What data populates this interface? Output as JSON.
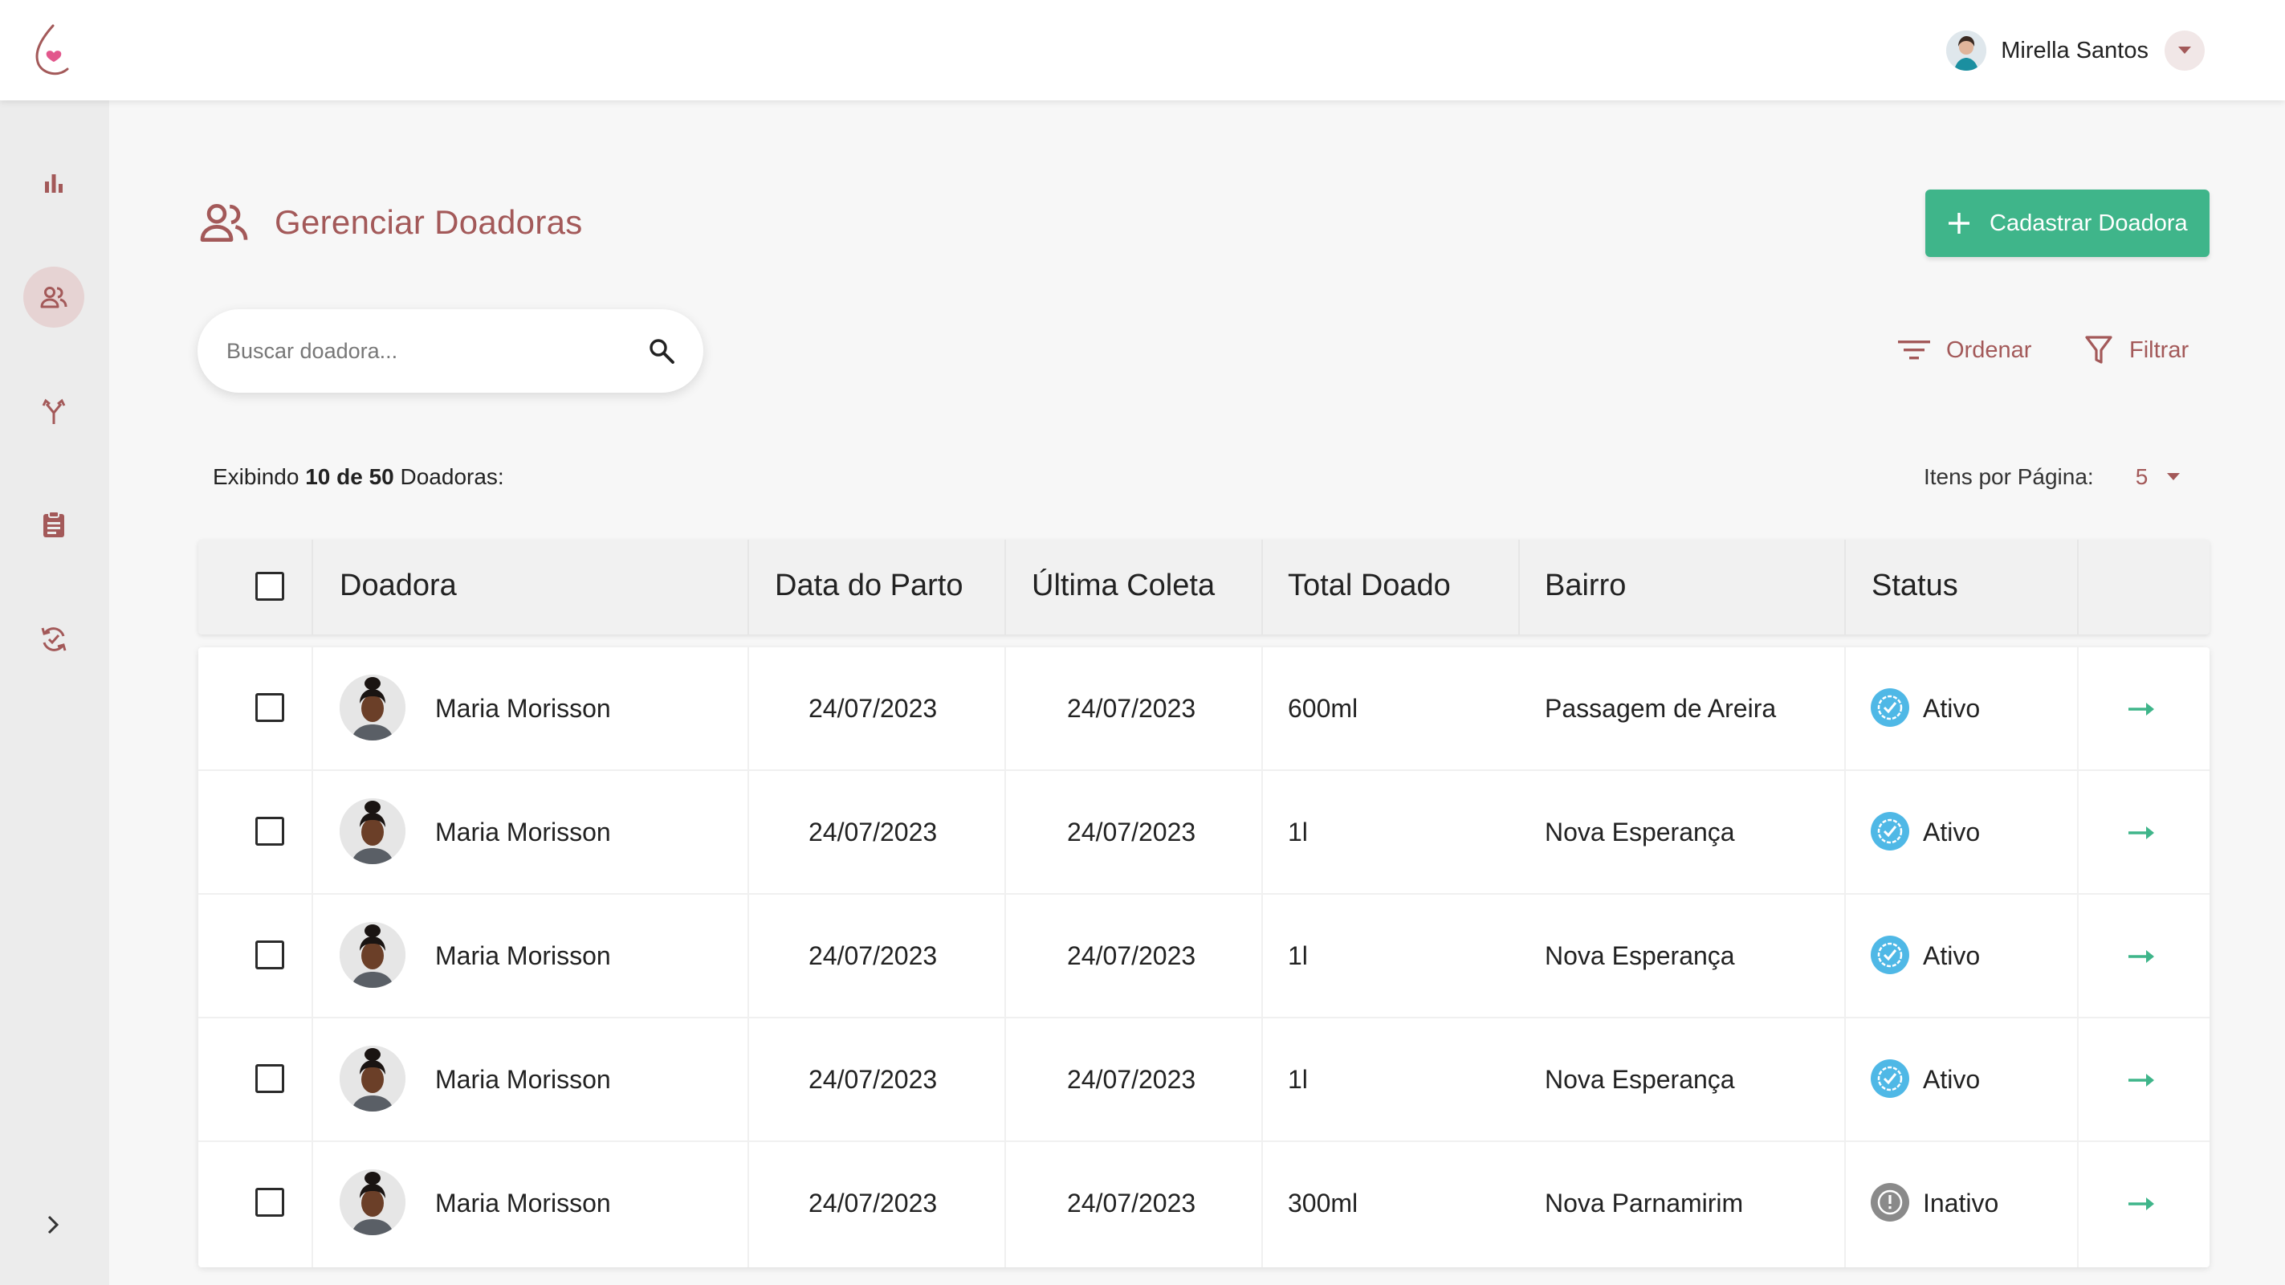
{
  "app": {
    "logo": "milk-drop-heart-logo"
  },
  "user": {
    "name": "Mirella Santos"
  },
  "sidebar": {
    "items": [
      {
        "icon": "bar-chart-icon",
        "active": false
      },
      {
        "icon": "people-icon",
        "active": true
      },
      {
        "icon": "merge-icon",
        "active": false
      },
      {
        "icon": "clipboard-icon",
        "active": false
      },
      {
        "icon": "cycle-check-icon",
        "active": false
      }
    ],
    "expand_icon": "chevron-right-icon"
  },
  "page": {
    "title": "Gerenciar Doadoras",
    "title_icon": "people-icon"
  },
  "actions": {
    "add_label": "Cadastrar Doadora",
    "sort_label": "Ordenar",
    "filter_label": "Filtrar"
  },
  "search": {
    "placeholder": "Buscar doadora...",
    "value": ""
  },
  "summary": {
    "prefix": "Exibindo",
    "shown": "10 de 50",
    "suffix": "Doadoras:"
  },
  "pagination": {
    "label": "Itens por Página:",
    "value": "5"
  },
  "colors": {
    "brand": "#a35959",
    "accent": "#3fb58a",
    "active_status": "#4fb8e6",
    "inactive_status": "#8a8a8a"
  },
  "table": {
    "headers": {
      "donor": "Doadora",
      "birth_date": "Data do Parto",
      "last_collection": "Última Coleta",
      "total": "Total Doado",
      "district": "Bairro",
      "status": "Status"
    },
    "rows": [
      {
        "name": "Maria Morisson",
        "birth_date": "24/07/2023",
        "last_collection": "24/07/2023",
        "total": "600ml",
        "district": "Passagem de Areira",
        "status": "Ativo",
        "active": true
      },
      {
        "name": "Maria Morisson",
        "birth_date": "24/07/2023",
        "last_collection": "24/07/2023",
        "total": "1l",
        "district": "Nova Esperança",
        "status": "Ativo",
        "active": true
      },
      {
        "name": "Maria Morisson",
        "birth_date": "24/07/2023",
        "last_collection": "24/07/2023",
        "total": "1l",
        "district": "Nova Esperança",
        "status": "Ativo",
        "active": true
      },
      {
        "name": "Maria Morisson",
        "birth_date": "24/07/2023",
        "last_collection": "24/07/2023",
        "total": "1l",
        "district": "Nova Esperança",
        "status": "Ativo",
        "active": true
      },
      {
        "name": "Maria Morisson",
        "birth_date": "24/07/2023",
        "last_collection": "24/07/2023",
        "total": "300ml",
        "district": "Nova Parnamirim",
        "status": "Inativo",
        "active": false
      }
    ]
  }
}
